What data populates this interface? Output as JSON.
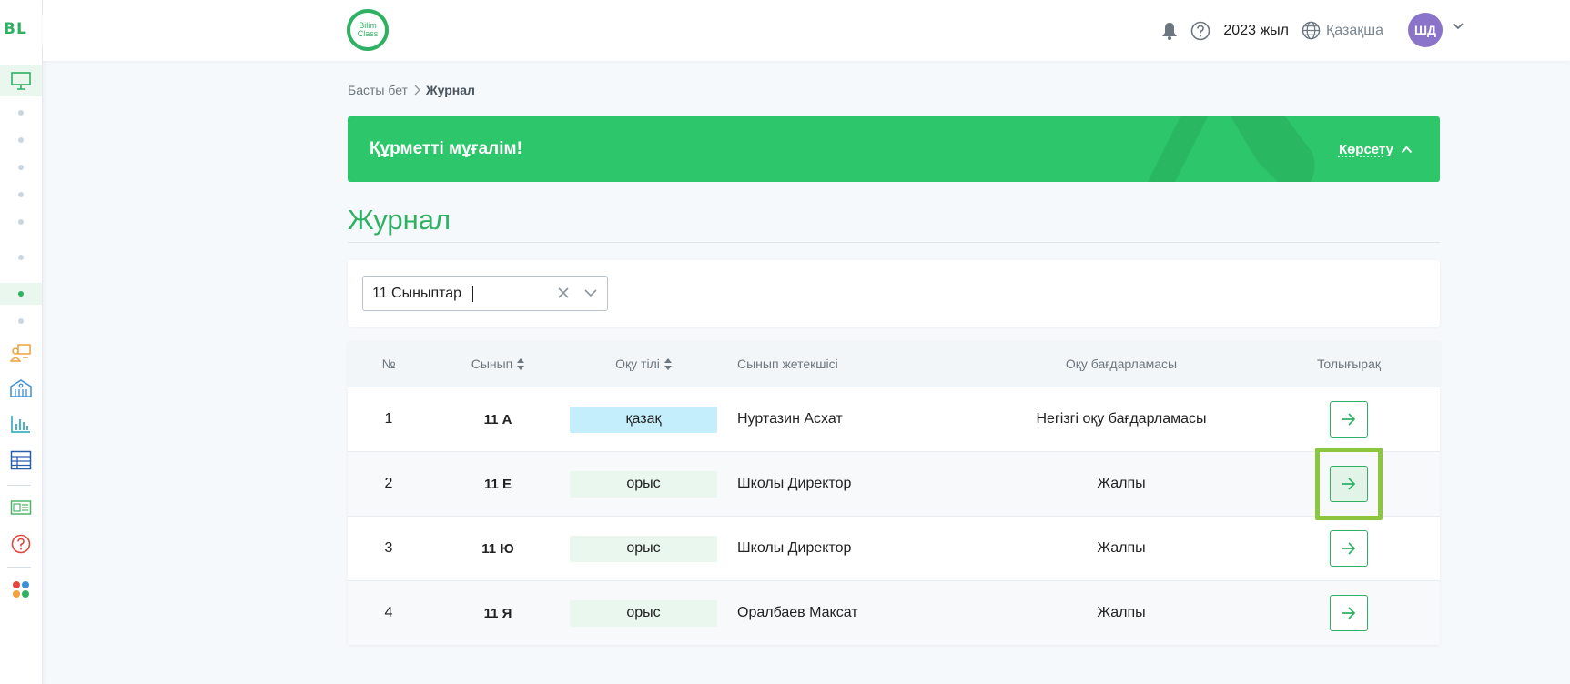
{
  "sidebar": {
    "logo": "BL",
    "icons": [
      "monitor-icon",
      "teacher-board-icon",
      "school-building-icon",
      "bar-chart-icon",
      "table-icon",
      "report-card-icon",
      "help-icon",
      "apps-grid-icon"
    ]
  },
  "header": {
    "brand_line1": "Bilim",
    "brand_line2": "Class",
    "year": "2023 жыл",
    "language": "Қазақша",
    "avatar_initials": "ШД"
  },
  "breadcrumb": {
    "home": "Басты бет",
    "current": "Журнал"
  },
  "banner": {
    "title": "Құрметті мұғалім!",
    "toggle_label": "Көрсету"
  },
  "page": {
    "title": "Журнал"
  },
  "filter": {
    "selected": "11 Сыныптар"
  },
  "table": {
    "headers": {
      "num": "№",
      "class": "Сынып",
      "language": "Оқу тілі",
      "teacher": "Сынып жетекшісі",
      "program": "Оқу бағдарламасы",
      "details": "Толығырақ"
    },
    "rows": [
      {
        "num": "1",
        "class": "11 А",
        "language": "қазақ",
        "teacher": "Нуртазин Асхат",
        "program": "Негізгі оқу бағдарламасы"
      },
      {
        "num": "2",
        "class": "11 Е",
        "language": "орыс",
        "teacher": "Школы Директор",
        "program": "Жалпы"
      },
      {
        "num": "3",
        "class": "11 Ю",
        "language": "орыс",
        "teacher": "Школы Директор",
        "program": "Жалпы"
      },
      {
        "num": "4",
        "class": "11 Я",
        "language": "орыс",
        "teacher": "Оралбаев Максат",
        "program": "Жалпы"
      }
    ]
  },
  "colors": {
    "accent": "#2fb163",
    "banner": "#2ec66b",
    "kazakh_badge": "#c4eefb",
    "russian_badge": "#e9f7ee",
    "highlight": "#8cc63f"
  }
}
